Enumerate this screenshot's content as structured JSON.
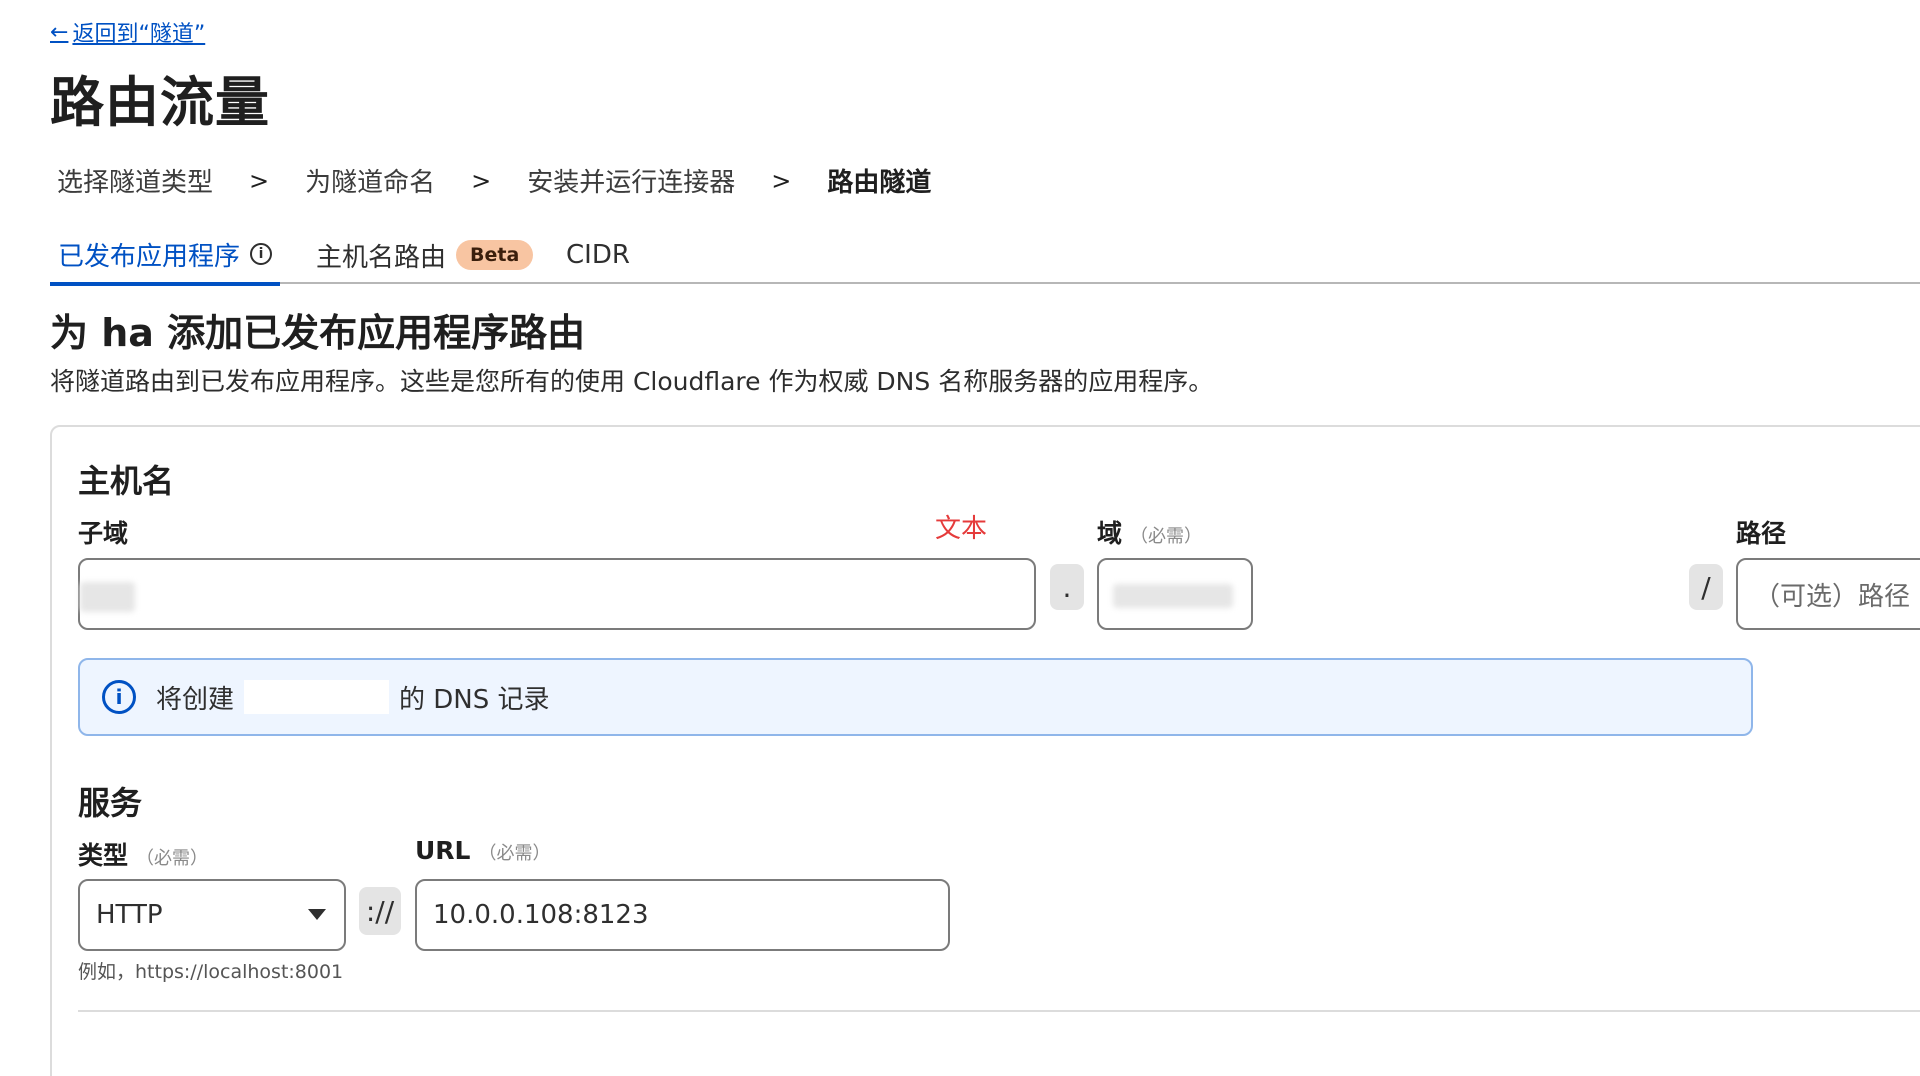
{
  "back_link": {
    "arrow": "←",
    "label": "返回到“隧道”"
  },
  "page_title": "路由流量",
  "steps": {
    "items": [
      "选择隧道类型",
      "为隧道命名",
      "安装并运行连接器",
      "路由隧道"
    ],
    "separator": ">"
  },
  "tabs": [
    {
      "label": "已发布应用程序",
      "icon": "info-icon",
      "active": true
    },
    {
      "label": "主机名路由",
      "badge": "Beta",
      "active": false
    },
    {
      "label": "CIDR",
      "active": false
    }
  ],
  "section": {
    "title": "为 ha 添加已发布应用程序路由",
    "description": "将隧道路由到已发布应用程序。这些是您所有的使用 Cloudflare 作为权威 DNS 名称服务器的应用程序。"
  },
  "hostname": {
    "heading": "主机名",
    "subdomain_label": "子域",
    "annotation": "文本",
    "domain_label": "域",
    "domain_required": "（必需）",
    "dot": ".",
    "path_label": "路径",
    "slash": "/",
    "path_placeholder": "（可选）路径"
  },
  "dns_notice": {
    "prefix": "将创建",
    "suffix": "的 DNS 记录"
  },
  "service": {
    "heading": "服务",
    "type_label": "类型",
    "type_required": "（必需）",
    "type_value": "HTTP",
    "scheme_sep": "://",
    "url_label": "URL",
    "url_required": "（必需）",
    "url_value": "10.0.0.108:8123",
    "helper": "例如，https://localhost:8001"
  },
  "colors": {
    "accent": "#0051c3",
    "badge_bg": "#f8c5a2",
    "annotation": "#e53b3b",
    "notice_bg": "#eef5ff"
  }
}
